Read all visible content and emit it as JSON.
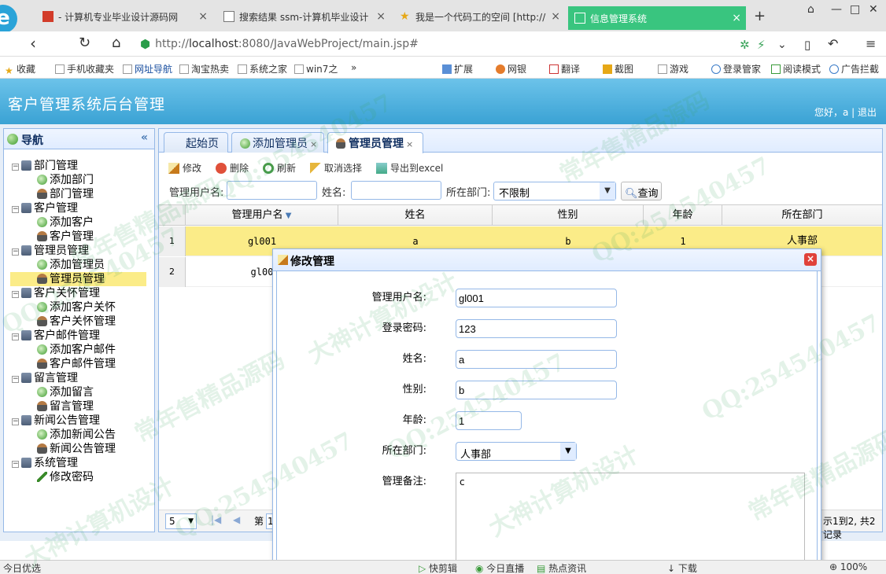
{
  "browser": {
    "tabs": [
      {
        "title": "- 计算机专业毕业设计源码网"
      },
      {
        "title": "搜索结果 ssm-计算机毕业设计"
      },
      {
        "title": "我是一个代码工的空间 [http://"
      },
      {
        "title": "信息管理系统",
        "active": true
      }
    ],
    "url_scheme": "http://",
    "url_host": "localhost",
    "url_rest": ":8080/JavaWebProject/main.jsp#",
    "bookmarks": [
      "收藏",
      "手机收藏夹",
      "网址导航",
      "淘宝热卖",
      "系统之家",
      "win7之",
      "»"
    ],
    "tools": [
      "扩展",
      "网银",
      "翻译",
      "截图",
      "游戏",
      "登录管家",
      "阅读模式",
      "广告拦截"
    ]
  },
  "app": {
    "title": "客户管理系统后台管理",
    "user_greeting": "您好，a",
    "logout": "退出"
  },
  "nav": {
    "title": "导航",
    "collapse_glyph": "«",
    "groups": [
      {
        "label": "部门管理",
        "items": [
          "添加部门",
          "部门管理"
        ]
      },
      {
        "label": "客户管理",
        "items": [
          "添加客户",
          "客户管理"
        ]
      },
      {
        "label": "管理员管理",
        "items": [
          "添加管理员",
          "管理员管理"
        ]
      },
      {
        "label": "客户关怀管理",
        "items": [
          "添加客户关怀",
          "客户关怀管理"
        ]
      },
      {
        "label": "客户邮件管理",
        "items": [
          "添加客户邮件",
          "客户邮件管理"
        ]
      },
      {
        "label": "留言管理",
        "items": [
          "添加留言",
          "留言管理"
        ]
      },
      {
        "label": "新闻公告管理",
        "items": [
          "添加新闻公告",
          "新闻公告管理"
        ]
      },
      {
        "label": "系统管理",
        "items": [
          "修改密码"
        ]
      }
    ],
    "selected": "管理员管理"
  },
  "main": {
    "tabs": [
      {
        "label": "起始页"
      },
      {
        "label": "添加管理员",
        "close": "×"
      },
      {
        "label": "管理员管理",
        "close": "×",
        "active": true
      }
    ],
    "toolbar": [
      "修改",
      "删除",
      "刷新",
      "取消选择",
      "导出到excel"
    ],
    "search": {
      "username_label": "管理用户名:",
      "name_label": "姓名:",
      "dept_label": "所在部门:",
      "dept_value": "不限制",
      "button": "查询"
    },
    "grid": {
      "columns": [
        "管理用户名",
        "姓名",
        "性别",
        "年龄",
        "所在部门"
      ],
      "rows": [
        {
          "num": "1",
          "cells": [
            "gl001",
            "a",
            "b",
            "1",
            "人事部"
          ]
        },
        {
          "num": "2",
          "cells": [
            "gl00",
            "",
            "",
            "",
            ""
          ]
        }
      ]
    },
    "pager": {
      "page_size": "5",
      "page_label": "第",
      "page_value": "1",
      "summary": "示1到2, 共2记录"
    }
  },
  "dialog": {
    "title": "修改管理",
    "close_glyph": "×",
    "fields": [
      {
        "label": "管理用户名:",
        "value": "gl001"
      },
      {
        "label": "登录密码:",
        "value": "123"
      },
      {
        "label": "姓名:",
        "value": "a"
      },
      {
        "label": "性别:",
        "value": "b"
      },
      {
        "label": "年龄:",
        "value": "1"
      }
    ],
    "dept_label": "所在部门:",
    "dept_value": "人事部",
    "remark_label": "管理备注:",
    "remark_value": "c"
  },
  "statusbar": {
    "left": "今日优选",
    "items": [
      "快剪辑",
      "今日直播",
      "热点资讯",
      "下载",
      "100%"
    ]
  },
  "watermark": {
    "qq": "QQ:254540457",
    "text1": "常年售精品源码",
    "text2": "大神计算机设计"
  },
  "colors": {
    "header": "#4bb1e0",
    "active_tab": "#39c57f",
    "selection": "#fbec88",
    "border": "#95b8e7"
  }
}
